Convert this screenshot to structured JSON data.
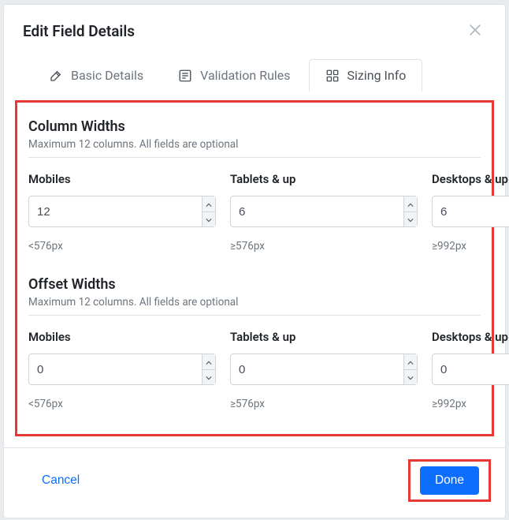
{
  "modal": {
    "title": "Edit Field Details"
  },
  "tabs": {
    "basic": "Basic Details",
    "validation": "Validation Rules",
    "sizing": "Sizing Info"
  },
  "sections": {
    "columnWidths": {
      "title": "Column Widths",
      "help": "Maximum 12 columns. All fields are optional",
      "fields": {
        "mobiles": {
          "label": "Mobiles",
          "value": "12",
          "hint": "<576px"
        },
        "tablets": {
          "label": "Tablets & up",
          "value": "6",
          "hint": "≥576px"
        },
        "desktops": {
          "label": "Desktops & up",
          "value": "6",
          "hint": "≥992px"
        }
      }
    },
    "offsetWidths": {
      "title": "Offset Widths",
      "help": "Maximum 12 columns. All fields are optional",
      "fields": {
        "mobiles": {
          "label": "Mobiles",
          "value": "0",
          "hint": "<576px"
        },
        "tablets": {
          "label": "Tablets & up",
          "value": "0",
          "hint": "≥576px"
        },
        "desktops": {
          "label": "Desktops & up",
          "value": "0",
          "hint": "≥992px"
        }
      }
    }
  },
  "footer": {
    "cancel": "Cancel",
    "done": "Done"
  }
}
